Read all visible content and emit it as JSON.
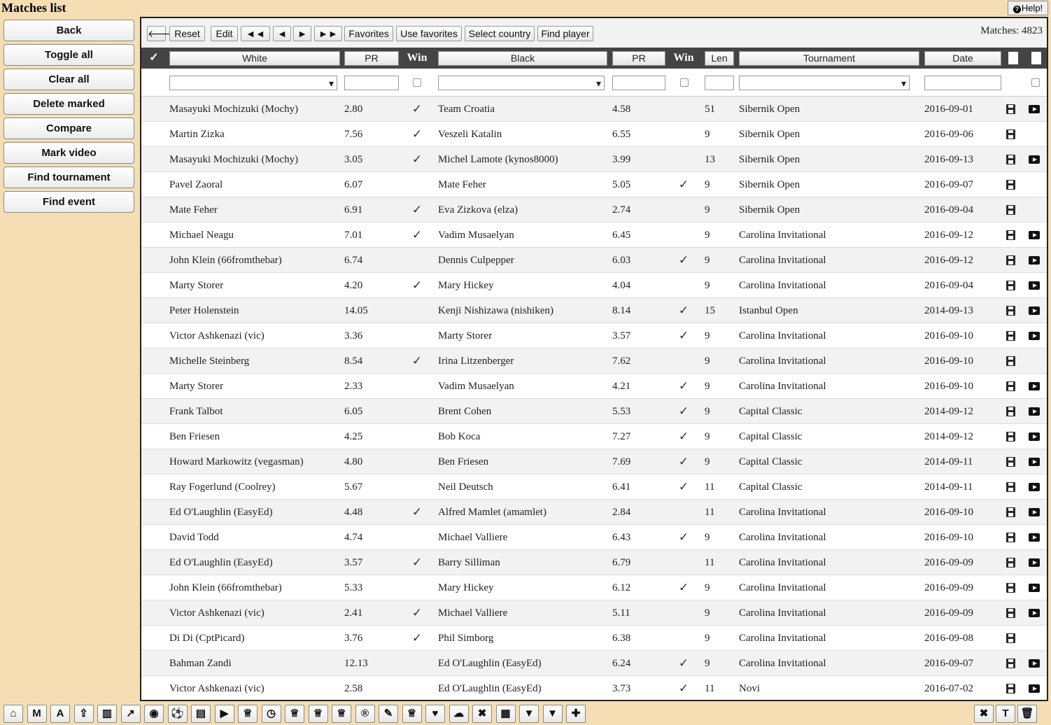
{
  "app": {
    "title": "Matches list",
    "help_label": "Help!"
  },
  "sidebar": {
    "buttons": [
      "Back",
      "Toggle all",
      "Clear all",
      "Delete marked",
      "Compare",
      "Mark video",
      "Find tournament",
      "Find event"
    ]
  },
  "toolbar": {
    "back_arrow": "🡐",
    "reset": "Reset",
    "edit": "Edit",
    "first": "◄◄",
    "prev": "◄",
    "next": "►",
    "last": "►►",
    "favorites": "Favorites",
    "use_favorites": "Use favorites",
    "select_country": "Select country",
    "find_player": "Find player",
    "matches_count": "Matches: 4823"
  },
  "columns": {
    "check": "✓",
    "white": "White",
    "white_pr": "PR",
    "white_win": "Win",
    "black": "Black",
    "black_pr": "PR",
    "black_win": "Win",
    "len": "Len",
    "tournament": "Tournament",
    "date": "Date"
  },
  "rows": [
    {
      "white": "Masayuki Mochizuki (Mochy)",
      "wpr": "2.80",
      "wwin": true,
      "black": "Team Croatia",
      "bpr": "4.58",
      "bwin": false,
      "len": "51",
      "tournament": "Sibernik Open",
      "date": "2016-09-01",
      "video": true
    },
    {
      "white": "Martin Zizka",
      "wpr": "7.56",
      "wwin": true,
      "black": "Veszeli Katalin",
      "bpr": "6.55",
      "bwin": false,
      "len": "9",
      "tournament": "Sibernik Open",
      "date": "2016-09-06",
      "video": false
    },
    {
      "white": "Masayuki Mochizuki (Mochy)",
      "wpr": "3.05",
      "wwin": true,
      "black": "Michel Lamote (kynos8000)",
      "bpr": "3.99",
      "bwin": false,
      "len": "13",
      "tournament": "Sibernik Open",
      "date": "2016-09-13",
      "video": true
    },
    {
      "white": "Pavel Zaoral",
      "wpr": "6.07",
      "wwin": false,
      "black": "Mate Feher",
      "bpr": "5.05",
      "bwin": true,
      "len": "9",
      "tournament": "Sibernik Open",
      "date": "2016-09-07",
      "video": false
    },
    {
      "white": "Mate Feher",
      "wpr": "6.91",
      "wwin": true,
      "black": "Eva Zizkova (elza)",
      "bpr": "2.74",
      "bwin": false,
      "len": "9",
      "tournament": "Sibernik Open",
      "date": "2016-09-04",
      "video": false
    },
    {
      "white": "Michael Neagu",
      "wpr": "7.01",
      "wwin": true,
      "black": "Vadim Musaelyan",
      "bpr": "6.45",
      "bwin": false,
      "len": "9",
      "tournament": "Carolina Invitational",
      "date": "2016-09-12",
      "video": true
    },
    {
      "white": "John Klein (66fromthebar)",
      "wpr": "6.74",
      "wwin": false,
      "black": "Dennis Culpepper",
      "bpr": "6.03",
      "bwin": true,
      "len": "9",
      "tournament": "Carolina Invitational",
      "date": "2016-09-12",
      "video": true
    },
    {
      "white": "Marty Storer",
      "wpr": "4.20",
      "wwin": true,
      "black": "Mary Hickey",
      "bpr": "4.04",
      "bwin": false,
      "len": "9",
      "tournament": "Carolina Invitational",
      "date": "2016-09-04",
      "video": true
    },
    {
      "white": "Peter Holenstein",
      "wpr": "14.05",
      "wwin": false,
      "black": "Kenji Nishizawa (nishiken)",
      "bpr": "8.14",
      "bwin": true,
      "len": "15",
      "tournament": "Istanbul Open",
      "date": "2014-09-13",
      "video": true
    },
    {
      "white": "Victor Ashkenazi (vic)",
      "wpr": "3.36",
      "wwin": false,
      "black": "Marty Storer",
      "bpr": "3.57",
      "bwin": true,
      "len": "9",
      "tournament": "Carolina Invitational",
      "date": "2016-09-10",
      "video": true
    },
    {
      "white": "Michelle Steinberg",
      "wpr": "8.54",
      "wwin": true,
      "black": "Irina Litzenberger",
      "bpr": "7.62",
      "bwin": false,
      "len": "9",
      "tournament": "Carolina Invitational",
      "date": "2016-09-10",
      "video": false
    },
    {
      "white": "Marty Storer",
      "wpr": "2.33",
      "wwin": false,
      "black": "Vadim Musaelyan",
      "bpr": "4.21",
      "bwin": true,
      "len": "9",
      "tournament": "Carolina Invitational",
      "date": "2016-09-10",
      "video": true
    },
    {
      "white": "Frank Talbot",
      "wpr": "6.05",
      "wwin": false,
      "black": "Brent Cohen",
      "bpr": "5.53",
      "bwin": true,
      "len": "9",
      "tournament": "Capital Classic",
      "date": "2014-09-12",
      "video": true
    },
    {
      "white": "Ben Friesen",
      "wpr": "4.25",
      "wwin": false,
      "black": "Bob Koca",
      "bpr": "7.27",
      "bwin": true,
      "len": "9",
      "tournament": "Capital Classic",
      "date": "2014-09-12",
      "video": true
    },
    {
      "white": "Howard Markowitz (vegasman)",
      "wpr": "4.80",
      "wwin": false,
      "black": "Ben Friesen",
      "bpr": "7.69",
      "bwin": true,
      "len": "9",
      "tournament": "Capital Classic",
      "date": "2014-09-11",
      "video": true
    },
    {
      "white": "Ray Fogerlund (Coolrey)",
      "wpr": "5.67",
      "wwin": false,
      "black": "Neil Deutsch",
      "bpr": "6.41",
      "bwin": true,
      "len": "11",
      "tournament": "Capital Classic",
      "date": "2014-09-11",
      "video": true
    },
    {
      "white": "Ed O'Laughlin (EasyEd)",
      "wpr": "4.48",
      "wwin": true,
      "black": "Alfred Mamlet (amamlet)",
      "bpr": "2.84",
      "bwin": false,
      "len": "11",
      "tournament": "Carolina Invitational",
      "date": "2016-09-10",
      "video": true
    },
    {
      "white": "David Todd",
      "wpr": "4.74",
      "wwin": false,
      "black": "Michael Valliere",
      "bpr": "6.43",
      "bwin": true,
      "len": "9",
      "tournament": "Carolina Invitational",
      "date": "2016-09-10",
      "video": true
    },
    {
      "white": "Ed O'Laughlin (EasyEd)",
      "wpr": "3.57",
      "wwin": true,
      "black": "Barry Silliman",
      "bpr": "6.79",
      "bwin": false,
      "len": "11",
      "tournament": "Carolina Invitational",
      "date": "2016-09-09",
      "video": true
    },
    {
      "white": "John Klein (66fromthebar)",
      "wpr": "5.33",
      "wwin": false,
      "black": "Mary Hickey",
      "bpr": "6.12",
      "bwin": true,
      "len": "9",
      "tournament": "Carolina Invitational",
      "date": "2016-09-09",
      "video": true
    },
    {
      "white": "Victor Ashkenazi (vic)",
      "wpr": "2.41",
      "wwin": true,
      "black": "Michael Valliere",
      "bpr": "5.11",
      "bwin": false,
      "len": "9",
      "tournament": "Carolina Invitational",
      "date": "2016-09-09",
      "video": true
    },
    {
      "white": "Di Di (CptPicard)",
      "wpr": "3.76",
      "wwin": true,
      "black": "Phil Simborg",
      "bpr": "6.38",
      "bwin": false,
      "len": "9",
      "tournament": "Carolina Invitational",
      "date": "2016-09-08",
      "video": false
    },
    {
      "white": "Bahman Zandi",
      "wpr": "12.13",
      "wwin": false,
      "black": "Ed O'Laughlin (EasyEd)",
      "bpr": "6.24",
      "bwin": true,
      "len": "9",
      "tournament": "Carolina Invitational",
      "date": "2016-09-07",
      "video": true
    },
    {
      "white": "Victor Ashkenazi (vic)",
      "wpr": "2.58",
      "wwin": false,
      "black": "Ed O'Laughlin (EasyEd)",
      "bpr": "3.73",
      "bwin": true,
      "len": "11",
      "tournament": "Novi",
      "date": "2016-07-02",
      "video": true
    }
  ],
  "bottombar": {
    "left": [
      {
        "name": "home-icon",
        "glyph": "⌂"
      },
      {
        "name": "m-button",
        "glyph": "M"
      },
      {
        "name": "a-button",
        "glyph": "A"
      },
      {
        "name": "upload-icon",
        "glyph": "⇪"
      },
      {
        "name": "bar-chart-icon",
        "glyph": "▥"
      },
      {
        "name": "line-chart-icon",
        "glyph": "↗"
      },
      {
        "name": "eye-icon",
        "glyph": "◉"
      },
      {
        "name": "soccer-ball-icon",
        "glyph": "⚽"
      },
      {
        "name": "archive-icon",
        "glyph": "▤"
      },
      {
        "name": "play-icon",
        "glyph": "▶"
      },
      {
        "name": "trophy-icon",
        "glyph": "♕"
      },
      {
        "name": "clock-icon",
        "glyph": "◷"
      },
      {
        "name": "trophy-icon-2",
        "glyph": "♕"
      },
      {
        "name": "trophy-icon-3",
        "glyph": "♕"
      },
      {
        "name": "trophy-icon-4",
        "glyph": "♕"
      },
      {
        "name": "registered-icon",
        "glyph": "®"
      },
      {
        "name": "edit-icon",
        "glyph": "✎"
      },
      {
        "name": "trophy-icon-5",
        "glyph": "♕"
      },
      {
        "name": "heart-icon",
        "glyph": "♥"
      },
      {
        "name": "chat-icon",
        "glyph": "☁"
      },
      {
        "name": "close-icon",
        "glyph": "✖"
      },
      {
        "name": "film-icon",
        "glyph": "▦"
      },
      {
        "name": "bookmark-icon",
        "glyph": "▼"
      },
      {
        "name": "bookmark-icon-2",
        "glyph": "▼"
      },
      {
        "name": "plus-icon",
        "glyph": "✚"
      }
    ],
    "right": [
      {
        "name": "close-right-icon",
        "glyph": "✖"
      },
      {
        "name": "t-button",
        "glyph": "T"
      },
      {
        "name": "trash-icon",
        "glyph": "🗑"
      }
    ]
  }
}
